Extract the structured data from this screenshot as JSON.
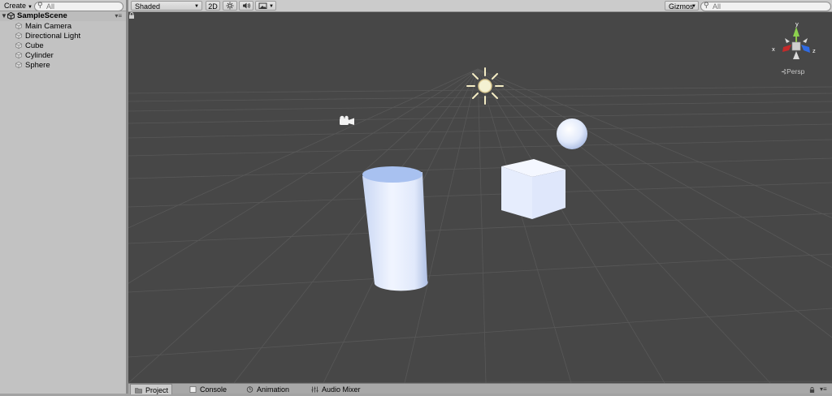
{
  "hierarchy": {
    "create_label": "Create",
    "search_placeholder": "All",
    "scene_name": "SampleScene",
    "items": [
      {
        "label": "Main Camera"
      },
      {
        "label": "Directional Light"
      },
      {
        "label": "Cube"
      },
      {
        "label": "Cylinder"
      },
      {
        "label": "Sphere"
      }
    ]
  },
  "scene_toolbar": {
    "draw_mode": "Shaded",
    "mode_2d": "2D",
    "gizmos_label": "Gizmos",
    "search_placeholder": "All"
  },
  "scene_view": {
    "projection_label": "Persp",
    "axis_x": "x",
    "axis_y": "y",
    "axis_z": "z",
    "background_color": "#474747"
  },
  "bottom_tabs": [
    {
      "label": "Project",
      "icon": "folder-icon"
    },
    {
      "label": "Console",
      "icon": "console-icon"
    },
    {
      "label": "Animation",
      "icon": "animation-icon"
    },
    {
      "label": "Audio Mixer",
      "icon": "audio-mixer-icon"
    }
  ]
}
